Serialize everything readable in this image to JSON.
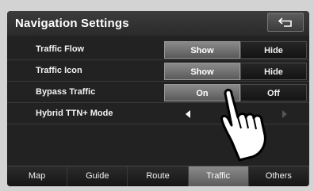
{
  "header": {
    "title": "Navigation Settings",
    "back_icon": "back-arrow-icon"
  },
  "rows": [
    {
      "label": "Traffic Flow",
      "options": [
        "Show",
        "Hide"
      ],
      "selected": 0
    },
    {
      "label": "Traffic Icon",
      "options": [
        "Show",
        "Hide"
      ],
      "selected": 0
    },
    {
      "label": "Bypass Traffic",
      "options": [
        "On",
        "Off"
      ],
      "selected": 0
    },
    {
      "label": "Hybrid TTN+ Mode",
      "left_icon": "left-arrow-icon",
      "right_icon": "right-arrow-icon"
    }
  ],
  "tabs": [
    {
      "label": "Map",
      "active": false
    },
    {
      "label": "Guide",
      "active": false
    },
    {
      "label": "Route",
      "active": false
    },
    {
      "label": "Traffic",
      "active": true
    },
    {
      "label": "Others",
      "active": false
    }
  ]
}
